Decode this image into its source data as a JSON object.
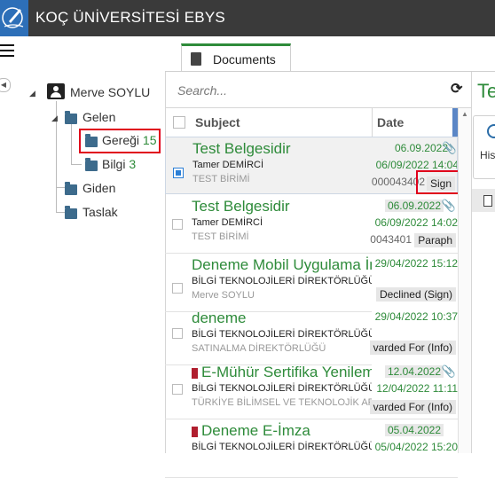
{
  "app": {
    "title": "KOÇ ÜNİVERSİTESİ EBYS"
  },
  "tabs": [
    {
      "label": "Documents",
      "active": true
    }
  ],
  "tree": {
    "user": "Merve SOYLU",
    "incoming": "Gelen",
    "gereği": {
      "label": "Gereği",
      "count": "15"
    },
    "bilgi": {
      "label": "Bilgi",
      "count": "3"
    },
    "outgoing": "Giden",
    "draft": "Taslak"
  },
  "search": {
    "placeholder": "Search..."
  },
  "table": {
    "headers": {
      "subject": "Subject",
      "date": "Date"
    },
    "rows": [
      {
        "subject": "Test Belgesidir",
        "sender": "Tamer DEMİRCİ",
        "unit": "TEST BİRİMİ",
        "date1": "06.09.2022",
        "date2": "06/09/2022 14:04",
        "docno": "000043402",
        "action": "Sign",
        "checked": true,
        "attachment": true
      },
      {
        "subject": "Test Belgesidir",
        "sender": "Tamer DEMİRCİ",
        "unit": "TEST BİRİMİ",
        "date1": "06.09.2022",
        "date2": "06/09/2022 14:02",
        "docno": "0043401",
        "action": "Paraph",
        "checked": false,
        "attachment": true
      },
      {
        "subject": "Deneme Mobil Uygulama İmza",
        "sender": "BİLGİ TEKNOLOJİLERİ DİREKTÖRLÜĞÜ",
        "unit": "Merve SOYLU",
        "date1": "",
        "date2": "29/04/2022 15:12",
        "docno": "",
        "action": "Declined (Sign)",
        "checked": false,
        "attachment": false
      },
      {
        "subject": "deneme",
        "sender": "BİLGİ TEKNOLOJİLERİ DİREKTÖRLÜĞÜ",
        "unit": "SATINALMA DİREKTÖRLÜĞÜ",
        "date1": "",
        "date2": "29/04/2022 10:37",
        "docno": "",
        "action": "varded For (Info)",
        "checked": false,
        "attachment": false
      },
      {
        "subject": "E-Mühür Sertifika Yenileme",
        "sender": "BİLGİ TEKNOLOJİLERİ DİREKTÖRLÜĞÜ",
        "unit": "TÜRKİYE BİLİMSEL VE TEKNOLOJİK ARAŞTIRMA",
        "date1": "12.04.2022",
        "date2": "12/04/2022 11:11",
        "docno": "",
        "action": "varded For (Info)",
        "checked": false,
        "attachment": true,
        "flag": true
      },
      {
        "subject": "Deneme E-İmza",
        "sender": "BİLGİ TEKNOLOJİLERİ DİREKTÖRLÜĞÜ",
        "unit": "",
        "date1": "05.04.2022",
        "date2": "05/04/2022 15:20",
        "docno": "",
        "action": "",
        "checked": false,
        "attachment": false,
        "flag": true
      }
    ]
  },
  "right_panel": {
    "title": "Te",
    "history": "His"
  },
  "colors": {
    "accent_green": "#2e8b3a",
    "titlebar": "#3a3a3a",
    "highlight_red": "#e0001b",
    "logo_blue": "#2d6fb8"
  }
}
